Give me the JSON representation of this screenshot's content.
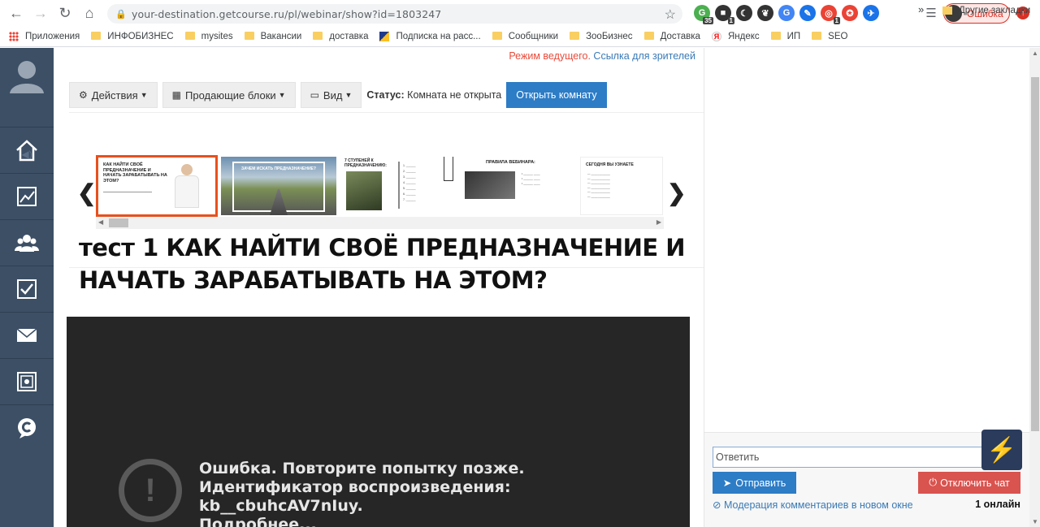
{
  "browser": {
    "url": "your-destination.getcourse.ru/pl/webinar/show?id=1803247",
    "extensions": [
      {
        "name": "ext-green-icon",
        "badge": "35",
        "color": "#4caf50"
      },
      {
        "name": "ext-square-icon",
        "badge": "1",
        "color": "#333333"
      },
      {
        "name": "ext-moon-icon",
        "badge": "",
        "color": "#333333"
      },
      {
        "name": "ext-leaf-icon",
        "badge": "",
        "color": "#333333"
      },
      {
        "name": "ext-translate-icon",
        "badge": "",
        "color": "#4285f4"
      },
      {
        "name": "ext-feather-icon",
        "badge": "",
        "color": "#1a73e8"
      },
      {
        "name": "ext-target-icon",
        "badge": "1",
        "color": "#ea4335"
      },
      {
        "name": "ext-circle-icon",
        "badge": "",
        "color": "#ea4335"
      },
      {
        "name": "ext-rocket-icon",
        "badge": "",
        "color": "#1a73e8"
      }
    ],
    "profile_error": "Ошибка",
    "bookmarks": [
      {
        "label": "Приложения",
        "icon": "apps"
      },
      {
        "label": "ИНФОБИЗНЕС",
        "icon": "folder"
      },
      {
        "label": "mysites",
        "icon": "folder"
      },
      {
        "label": "Вакансии",
        "icon": "folder"
      },
      {
        "label": "доставка",
        "icon": "folder"
      },
      {
        "label": "Подписка на расс...",
        "icon": "podpiska"
      },
      {
        "label": "Сообщники",
        "icon": "folder"
      },
      {
        "label": "ЗооБизнес",
        "icon": "folder"
      },
      {
        "label": "Доставка",
        "icon": "folder"
      },
      {
        "label": "Яндекс",
        "icon": "yandex"
      },
      {
        "label": "ИП",
        "icon": "folder"
      },
      {
        "label": "SEO",
        "icon": "folder"
      }
    ],
    "bookmarks_more": "»",
    "other_bookmarks": "Другие закладки"
  },
  "mode": {
    "host_mode": "Режим ведущего.",
    "viewer_link": "Ссылка для зрителей"
  },
  "toolbar": {
    "actions": "Действия",
    "selling_blocks": "Продающие блоки",
    "view": "Вид",
    "status_label": "Статус:",
    "status_value": "Комната не открыта",
    "open_room": "Открыть комнату"
  },
  "slides": [
    {
      "title": "КАК НАЙТИ СВОЁ ПРЕДНАЗНАЧЕНИЕ И НАЧАТЬ ЗАРАБАТЫВАТЬ НА ЭТОМ?",
      "active": true
    },
    {
      "title": "ЗАЧЕМ ИСКАТЬ ПРЕДНАЗНАЧЕНИЕ?",
      "active": false
    },
    {
      "title": "7 СТУПЕНЕЙ К ПРЕДНАЗНАЧЕНИЮ:",
      "active": false
    },
    {
      "title": "ПРАВИЛА ВЕБИНАРА:",
      "active": false
    },
    {
      "title": "СЕГОДНЯ ВЫ УЗНАЕТЕ",
      "active": false
    }
  ],
  "webinar_title": "тест 1 КАК НАЙТИ СВОЁ ПРЕДНАЗНАЧЕНИЕ И НАЧАТЬ ЗАРАБАТЫВАТЬ НА ЭТОМ?",
  "player": {
    "error_text": "Ошибка. Повторите попытку позже. Идентификатор воспроизведения: kb__cbuhcAV7nIuy.",
    "more_link": "Подробнее..."
  },
  "chat": {
    "reply_placeholder": "Ответить",
    "send": "Отправить",
    "disable_chat": "Отключить чат",
    "moderation_link": "Модерация комментариев в новом окне",
    "online": "1 онлайн"
  }
}
